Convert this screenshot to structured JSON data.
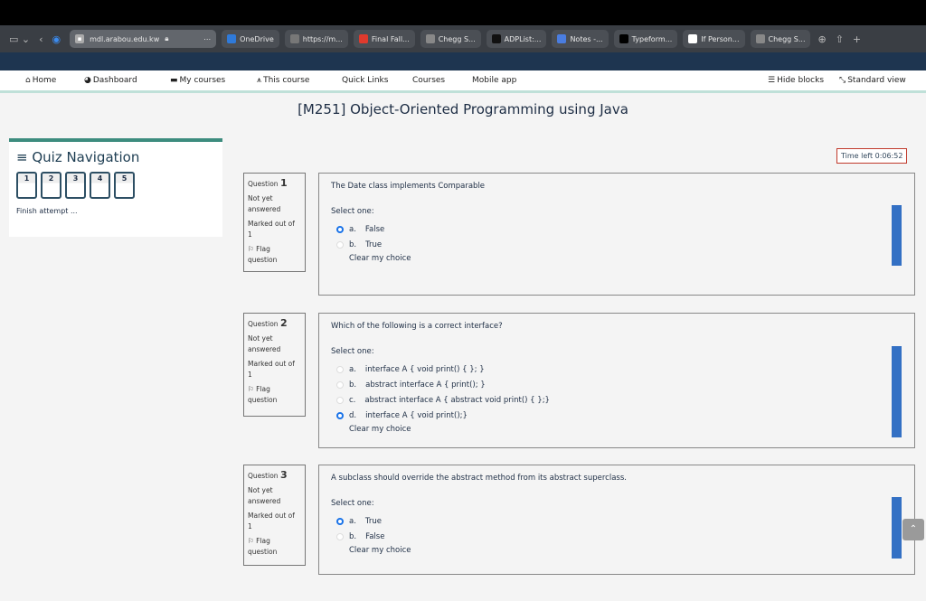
{
  "browser": {
    "url": "mdl.arabou.edu.kw",
    "tabs": [
      {
        "label": "OneDrive",
        "color": "#2f7ad9"
      },
      {
        "label": "https://m...",
        "color": "#777"
      },
      {
        "label": "Final Fall...",
        "color": "#e03a2d"
      },
      {
        "label": "Chegg S...",
        "color": "#888"
      },
      {
        "label": "ADPList:...",
        "color": "#111"
      },
      {
        "label": "Notes -...",
        "color": "#4a7de0"
      },
      {
        "label": "Typeform...",
        "color": "#000"
      },
      {
        "label": "If Person...",
        "color": "#fff"
      },
      {
        "label": "Chegg S...",
        "color": "#888"
      }
    ]
  },
  "nav": {
    "items": [
      "Home",
      "Dashboard",
      "My courses",
      "This course",
      "Quick Links",
      "Courses",
      "Mobile app"
    ],
    "hide_blocks": "Hide blocks",
    "standard_view": "Standard view"
  },
  "course_title": "[M251] Object-Oriented Programming using Java",
  "quiz_nav": {
    "title": "Quiz Navigation",
    "buttons": [
      "1",
      "2",
      "3",
      "4",
      "5"
    ],
    "finish": "Finish attempt ..."
  },
  "timer": "Time left 0:06:52",
  "questions": [
    {
      "label": "Question",
      "number": "1",
      "status": "Not yet answered",
      "marked": "Marked out of 1",
      "flag": "Flag question",
      "text": "The Date class implements Comparable",
      "select": "Select one:",
      "options": [
        {
          "letter": "a.",
          "text": "False",
          "selected": true
        },
        {
          "letter": "b.",
          "text": "True",
          "selected": false
        }
      ],
      "clear": "Clear my choice"
    },
    {
      "label": "Question",
      "number": "2",
      "status": "Not yet answered",
      "marked": "Marked out of 1",
      "flag": "Flag question",
      "text": "Which of the following is a correct interface?",
      "select": "Select one:",
      "options": [
        {
          "letter": "a.",
          "text": "interface A { void print() { }; }",
          "selected": false
        },
        {
          "letter": "b.",
          "text": "abstract interface A { print(); }",
          "selected": false
        },
        {
          "letter": "c.",
          "text": "abstract interface A { abstract void print() { };}",
          "selected": false
        },
        {
          "letter": "d.",
          "text": "interface A { void print();}",
          "selected": true
        }
      ],
      "clear": "Clear my choice"
    },
    {
      "label": "Question",
      "number": "3",
      "status": "Not yet answered",
      "marked": "Marked out of 1",
      "flag": "Flag question",
      "text": "A subclass should override the abstract method from its abstract superclass.",
      "select": "Select one:",
      "options": [
        {
          "letter": "a.",
          "text": "True",
          "selected": true
        },
        {
          "letter": "b.",
          "text": "False",
          "selected": false
        }
      ],
      "clear": "Clear my choice"
    }
  ]
}
